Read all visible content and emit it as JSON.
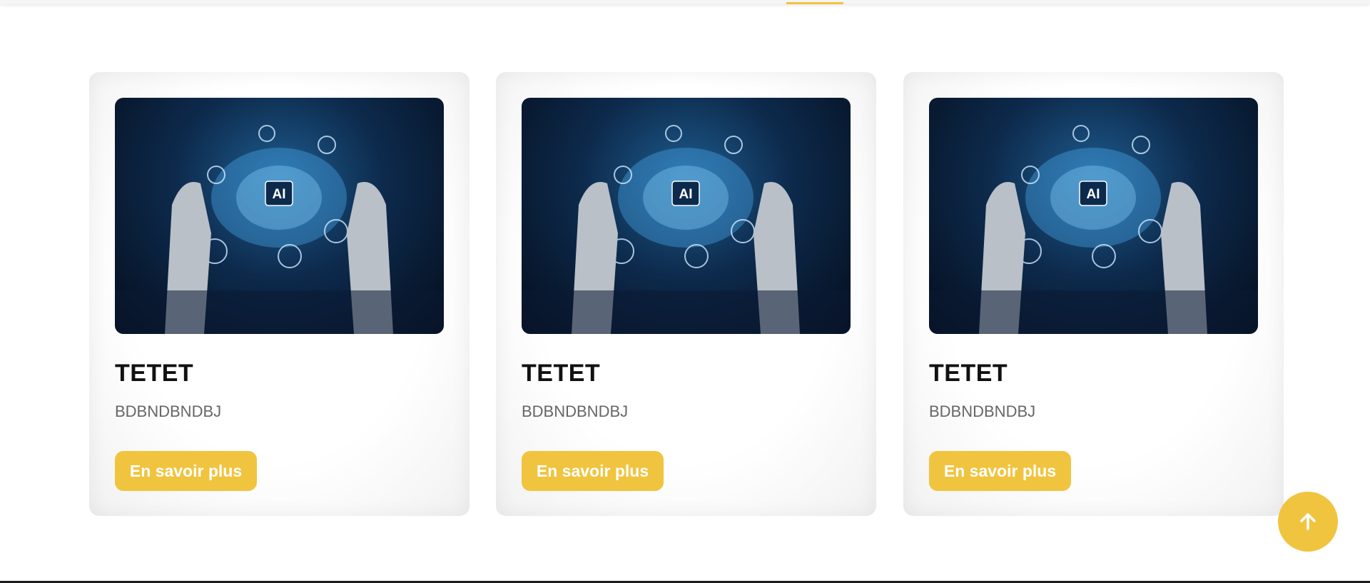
{
  "cards": [
    {
      "title": "TETET",
      "description": "BDBNDBNDBJ",
      "button_label": "En savoir plus",
      "image_icon": "ai-robot-hands-image",
      "image_text": "AI"
    },
    {
      "title": "TETET",
      "description": "BDBNDBNDBJ",
      "button_label": "En savoir plus",
      "image_icon": "ai-robot-hands-image",
      "image_text": "AI"
    },
    {
      "title": "TETET",
      "description": "BDBNDBNDBJ",
      "button_label": "En savoir plus",
      "image_icon": "ai-robot-hands-image",
      "image_text": "AI"
    }
  ],
  "scroll_top": {
    "icon": "arrow-up-icon"
  },
  "colors": {
    "accent": "#f0c43f",
    "title": "#111111",
    "description": "#666666",
    "button_text": "#ffffff"
  }
}
